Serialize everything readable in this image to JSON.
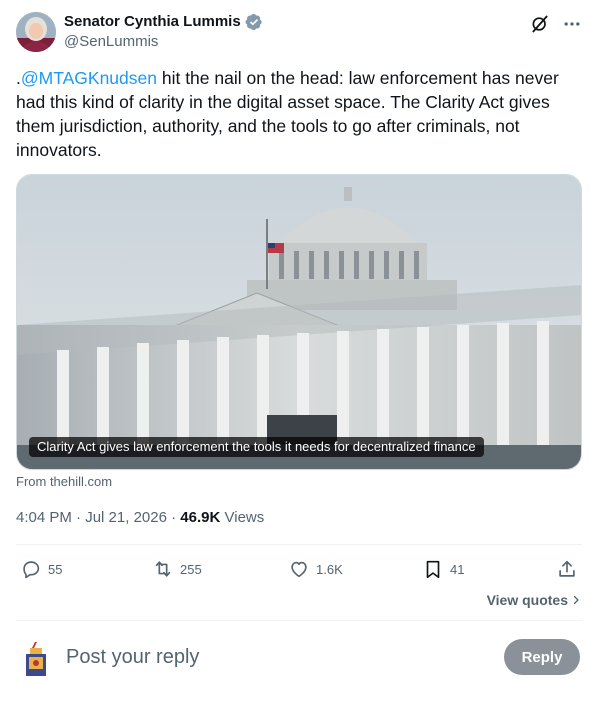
{
  "author": {
    "display_name": "Senator Cynthia Lummis",
    "handle": "@SenLummis",
    "verified": true,
    "verified_color": "#829aab"
  },
  "tweet": {
    "prefix": ".",
    "mention": "@MTAGKnudsen",
    "body": " hit the nail on the head: law enforcement has never had this kind of clarity in the digital asset space. The Clarity Act gives them jurisdiction, authority, and the tools to go after criminals, not innovators."
  },
  "card": {
    "caption": "Clarity Act gives law enforcement the tools it needs for decentralized finance",
    "source": "From thehill.com",
    "image_subject": "U.S. Capitol dome with flag"
  },
  "meta": {
    "time": "4:04 PM",
    "date": "Jul 21, 2026",
    "separator": "·",
    "views_count": "46.9K",
    "views_label": "Views"
  },
  "actions": {
    "replies": "55",
    "reposts": "255",
    "likes": "1.6K",
    "bookmarks": "41"
  },
  "view_quotes": "View quotes",
  "reply": {
    "placeholder": "Post your reply",
    "button_label": "Reply"
  },
  "colors": {
    "accent": "#1d9bf0",
    "secondary_text": "#536471",
    "divider": "#eff3f4"
  }
}
